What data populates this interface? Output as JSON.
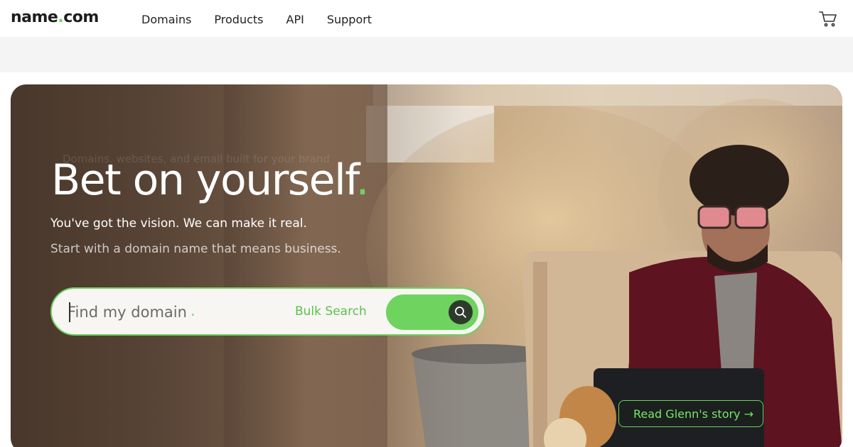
{
  "header": {
    "logo": {
      "name": "name",
      "dot": ".",
      "tld": "com"
    },
    "nav": [
      "Domains",
      "Products",
      "API",
      "Support"
    ],
    "cart_icon": "cart-icon"
  },
  "hero": {
    "faded_tagline": "Domains, websites, and email built for your brand",
    "headline": "Bet on yourself",
    "headline_dot": ".",
    "subtitle": "You've got the vision. We can make it real.",
    "subtitle2": "Start with a domain name that means business.",
    "search": {
      "placeholder": "Find my domain",
      "placeholder_dot": ".",
      "bulk_label": "Bulk Search",
      "button_icon": "search-icon"
    },
    "story_link": "Read Glenn's story →"
  },
  "colors": {
    "accent": "#6fd35f",
    "text_dark": "#222222",
    "band_bg": "#f4f4f4"
  }
}
